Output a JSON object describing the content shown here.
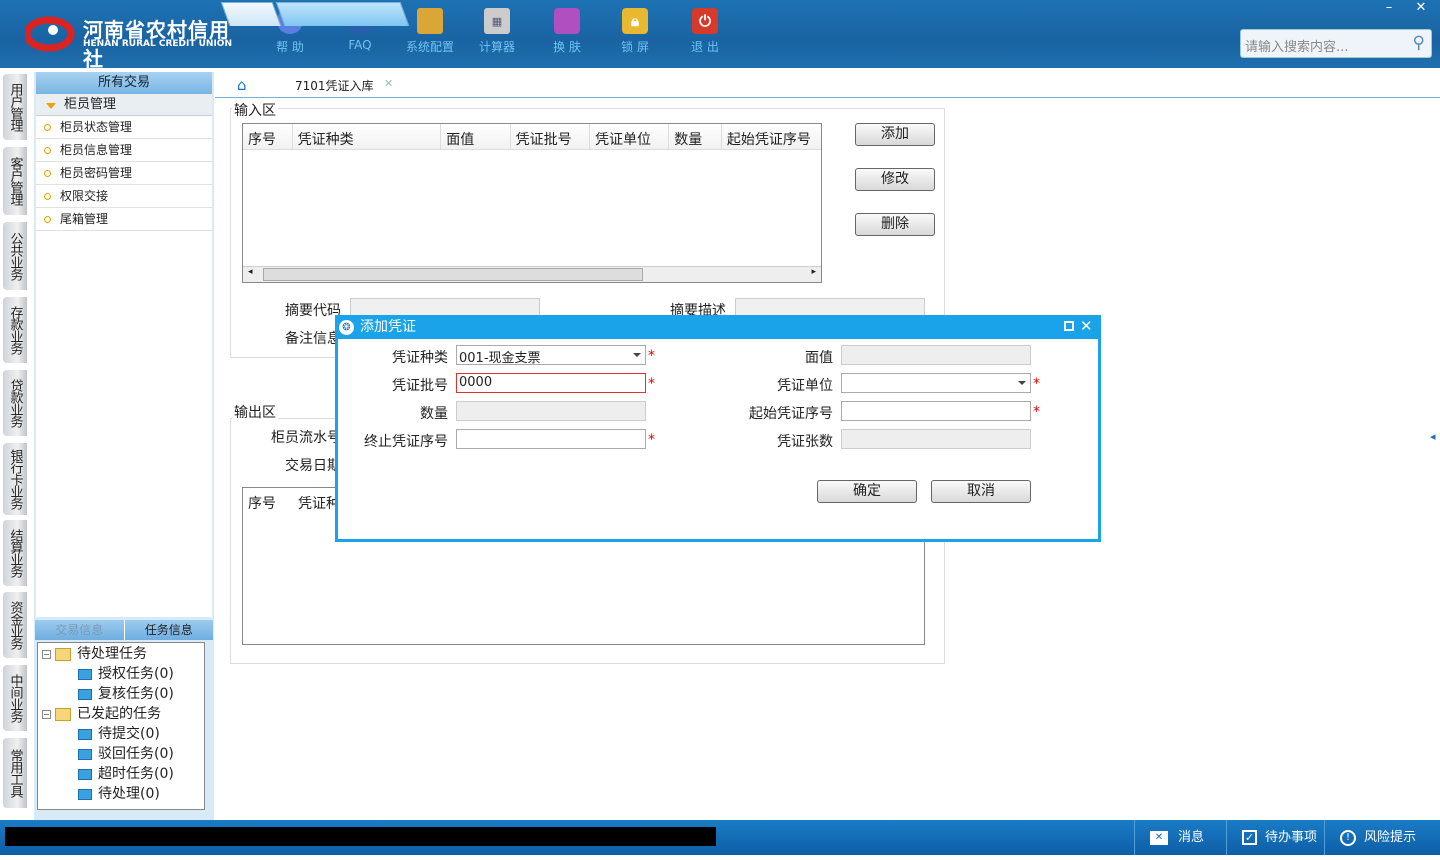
{
  "header": {
    "logo_cn": "河南省农村信用社",
    "logo_en": "HENAN RURAL CREDIT UNION",
    "tools": [
      {
        "label": "帮 助",
        "icon": "info-icon"
      },
      {
        "label": "FAQ",
        "icon": "help-icon"
      },
      {
        "label": "系统配置",
        "icon": "toolbox-icon"
      },
      {
        "label": "计算器",
        "icon": "calculator-icon"
      },
      {
        "label": "换 肤",
        "icon": "shirt-icon"
      },
      {
        "label": "锁 屏",
        "icon": "lock-icon"
      },
      {
        "label": "退 出",
        "icon": "power-icon"
      }
    ],
    "search_placeholder": "请输入搜索内容..."
  },
  "left_tabs": [
    "用户管理",
    "客户管理",
    "公共业务",
    "存款业务",
    "贷款业务",
    "银行卡业务",
    "结算业务",
    "资金业务",
    "中间业务",
    "常用工具"
  ],
  "sidebar": {
    "title": "所有交易",
    "group": "柜员管理",
    "items": [
      "柜员状态管理",
      "柜员信息管理",
      "柜员密码管理",
      "权限交接",
      "尾箱管理"
    ]
  },
  "tasks": {
    "tabs": [
      "交易信息",
      "任务信息"
    ],
    "nodes": [
      {
        "label": "待处理任务",
        "level": 0
      },
      {
        "label": "授权任务(0)",
        "level": 1
      },
      {
        "label": "复核任务(0)",
        "level": 1
      },
      {
        "label": "已发起的任务",
        "level": 0
      },
      {
        "label": "待提交(0)",
        "level": 1
      },
      {
        "label": "驳回任务(0)",
        "level": 1
      },
      {
        "label": "超时任务(0)",
        "level": 1
      },
      {
        "label": "待处理(0)",
        "level": 1
      }
    ]
  },
  "tabs": {
    "active": "7101凭证入库"
  },
  "input_area": {
    "legend": "输入区",
    "columns": [
      "序号",
      "凭证种类",
      "面值",
      "凭证批号",
      "凭证单位",
      "数量",
      "起始凭证序号"
    ],
    "buttons": {
      "add": "添加",
      "edit": "修改",
      "delete": "删除"
    },
    "summary_code": "摘要代码",
    "summary_desc": "摘要描述",
    "remark": "备注信息"
  },
  "output_area": {
    "legend": "输出区",
    "teller_serial": "柜员流水号",
    "trans_date": "交易日期",
    "columns": [
      "序号",
      "凭证种类"
    ]
  },
  "dialog": {
    "title": "添加凭证",
    "voucher_type_label": "凭证种类",
    "voucher_type": "001-现金支票",
    "face_value_label": "面值",
    "batch_label": "凭证批号",
    "batch": "0000",
    "unit_label": "凭证单位",
    "qty_label": "数量",
    "start_label": "起始凭证序号",
    "end_label": "终止凭证序号",
    "count_label": "凭证张数",
    "ok": "确定",
    "cancel": "取消",
    "required": "*"
  },
  "status": {
    "messages": "消息",
    "todo": "待办事项",
    "risk": "风险提示"
  }
}
